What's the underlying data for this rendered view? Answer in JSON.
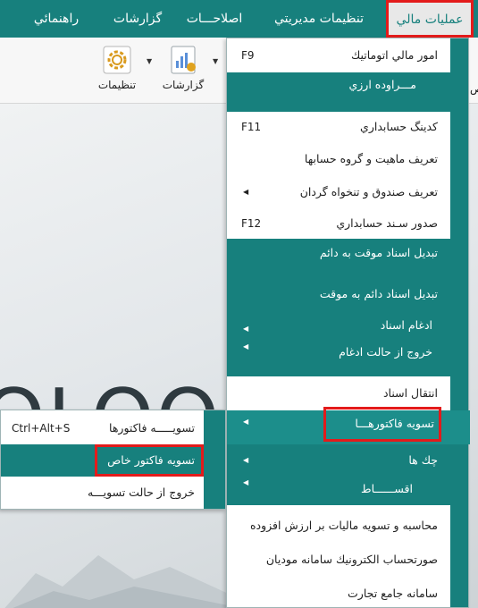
{
  "menubar": {
    "items": [
      {
        "label": "عمليات مالي"
      },
      {
        "label": "تنظيمات مديريتي"
      },
      {
        "label": "اصلاحـــات"
      },
      {
        "label": "گزارشات"
      },
      {
        "label": "راهنمائي"
      }
    ]
  },
  "ribbon": {
    "settings_label": "تنظيمات",
    "reports_label": "گزارشات",
    "edge_label": "ص"
  },
  "main_menu": {
    "items": [
      {
        "label": "امور مالي اتوماتيك",
        "shortcut": "F9"
      },
      {
        "label": "مـــراوده ارزي"
      },
      {
        "label": "كدينگ حسابداري",
        "shortcut": "F11"
      },
      {
        "label": "تعريف ماهيت و گروه حسابها"
      },
      {
        "label": "تعريف صندوق و تنخواه گردان",
        "arrow": "◀"
      },
      {
        "label": "صدور سـند حسابداري",
        "shortcut": "F12"
      },
      {
        "label": "تبديل اسناد موقت به دائم"
      },
      {
        "label": "تبديل اسناد دائم به موقت"
      },
      {
        "label": "ادغام اسناد",
        "arrow": "◀"
      },
      {
        "label": "خروج از حالت ادغام",
        "arrow": "◀"
      },
      {
        "label": "انتقال اسناد"
      },
      {
        "label": "تسويه فاكتورهـــا",
        "arrow": "◀"
      },
      {
        "label": "چك ها",
        "arrow": "◀"
      },
      {
        "label": "اقســــــاط",
        "arrow": "◀"
      },
      {
        "label": "محاسبه و تسويه ماليات بر ارزش افزوده"
      },
      {
        "label": "صورتحساب الكترونيك سامانه موديان"
      },
      {
        "label": "سامانه جامع تجارت"
      }
    ]
  },
  "sub_menu": {
    "items": [
      {
        "label": "تسويـــــه فاكتورها",
        "shortcut": "Ctrl+Alt+S"
      },
      {
        "label": "تسويه فاكتور خاص"
      },
      {
        "label": "خروج از حالت تسويـــه"
      }
    ]
  },
  "background": {
    "deco_text": "OLOO"
  },
  "colors": {
    "teal": "#17807d",
    "highlight": "#e31b1b"
  }
}
